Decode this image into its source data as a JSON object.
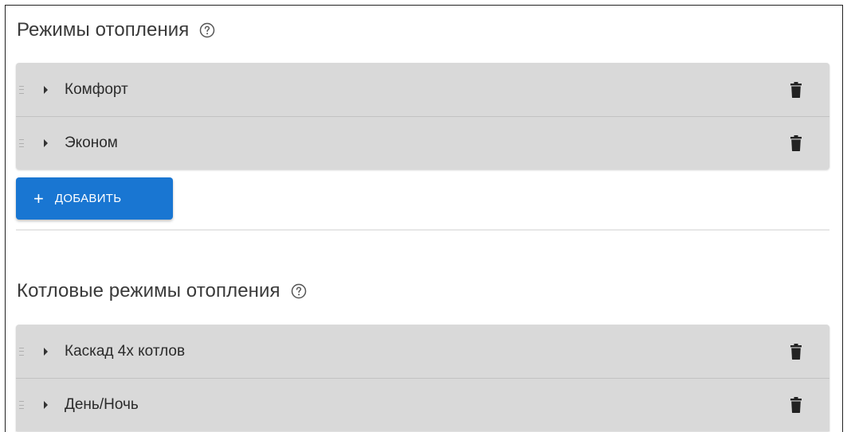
{
  "sections": [
    {
      "title": "Режимы отопления",
      "items": [
        {
          "label": "Комфорт"
        },
        {
          "label": "Эконом"
        }
      ],
      "add_button": {
        "icon": "+",
        "label": "ДОБАВИТЬ"
      }
    },
    {
      "title": "Котловые режимы отопления",
      "items": [
        {
          "label": "Каскад 4х котлов"
        },
        {
          "label": "День/Ночь"
        }
      ]
    }
  ],
  "colors": {
    "accent": "#1976d2",
    "list_bg": "#d9d9d9",
    "icon": "#222222"
  },
  "icons": {
    "help": "question-circle-icon",
    "expand": "caret-right-icon",
    "delete": "trash-icon",
    "drag": "drag-handle-icon"
  }
}
